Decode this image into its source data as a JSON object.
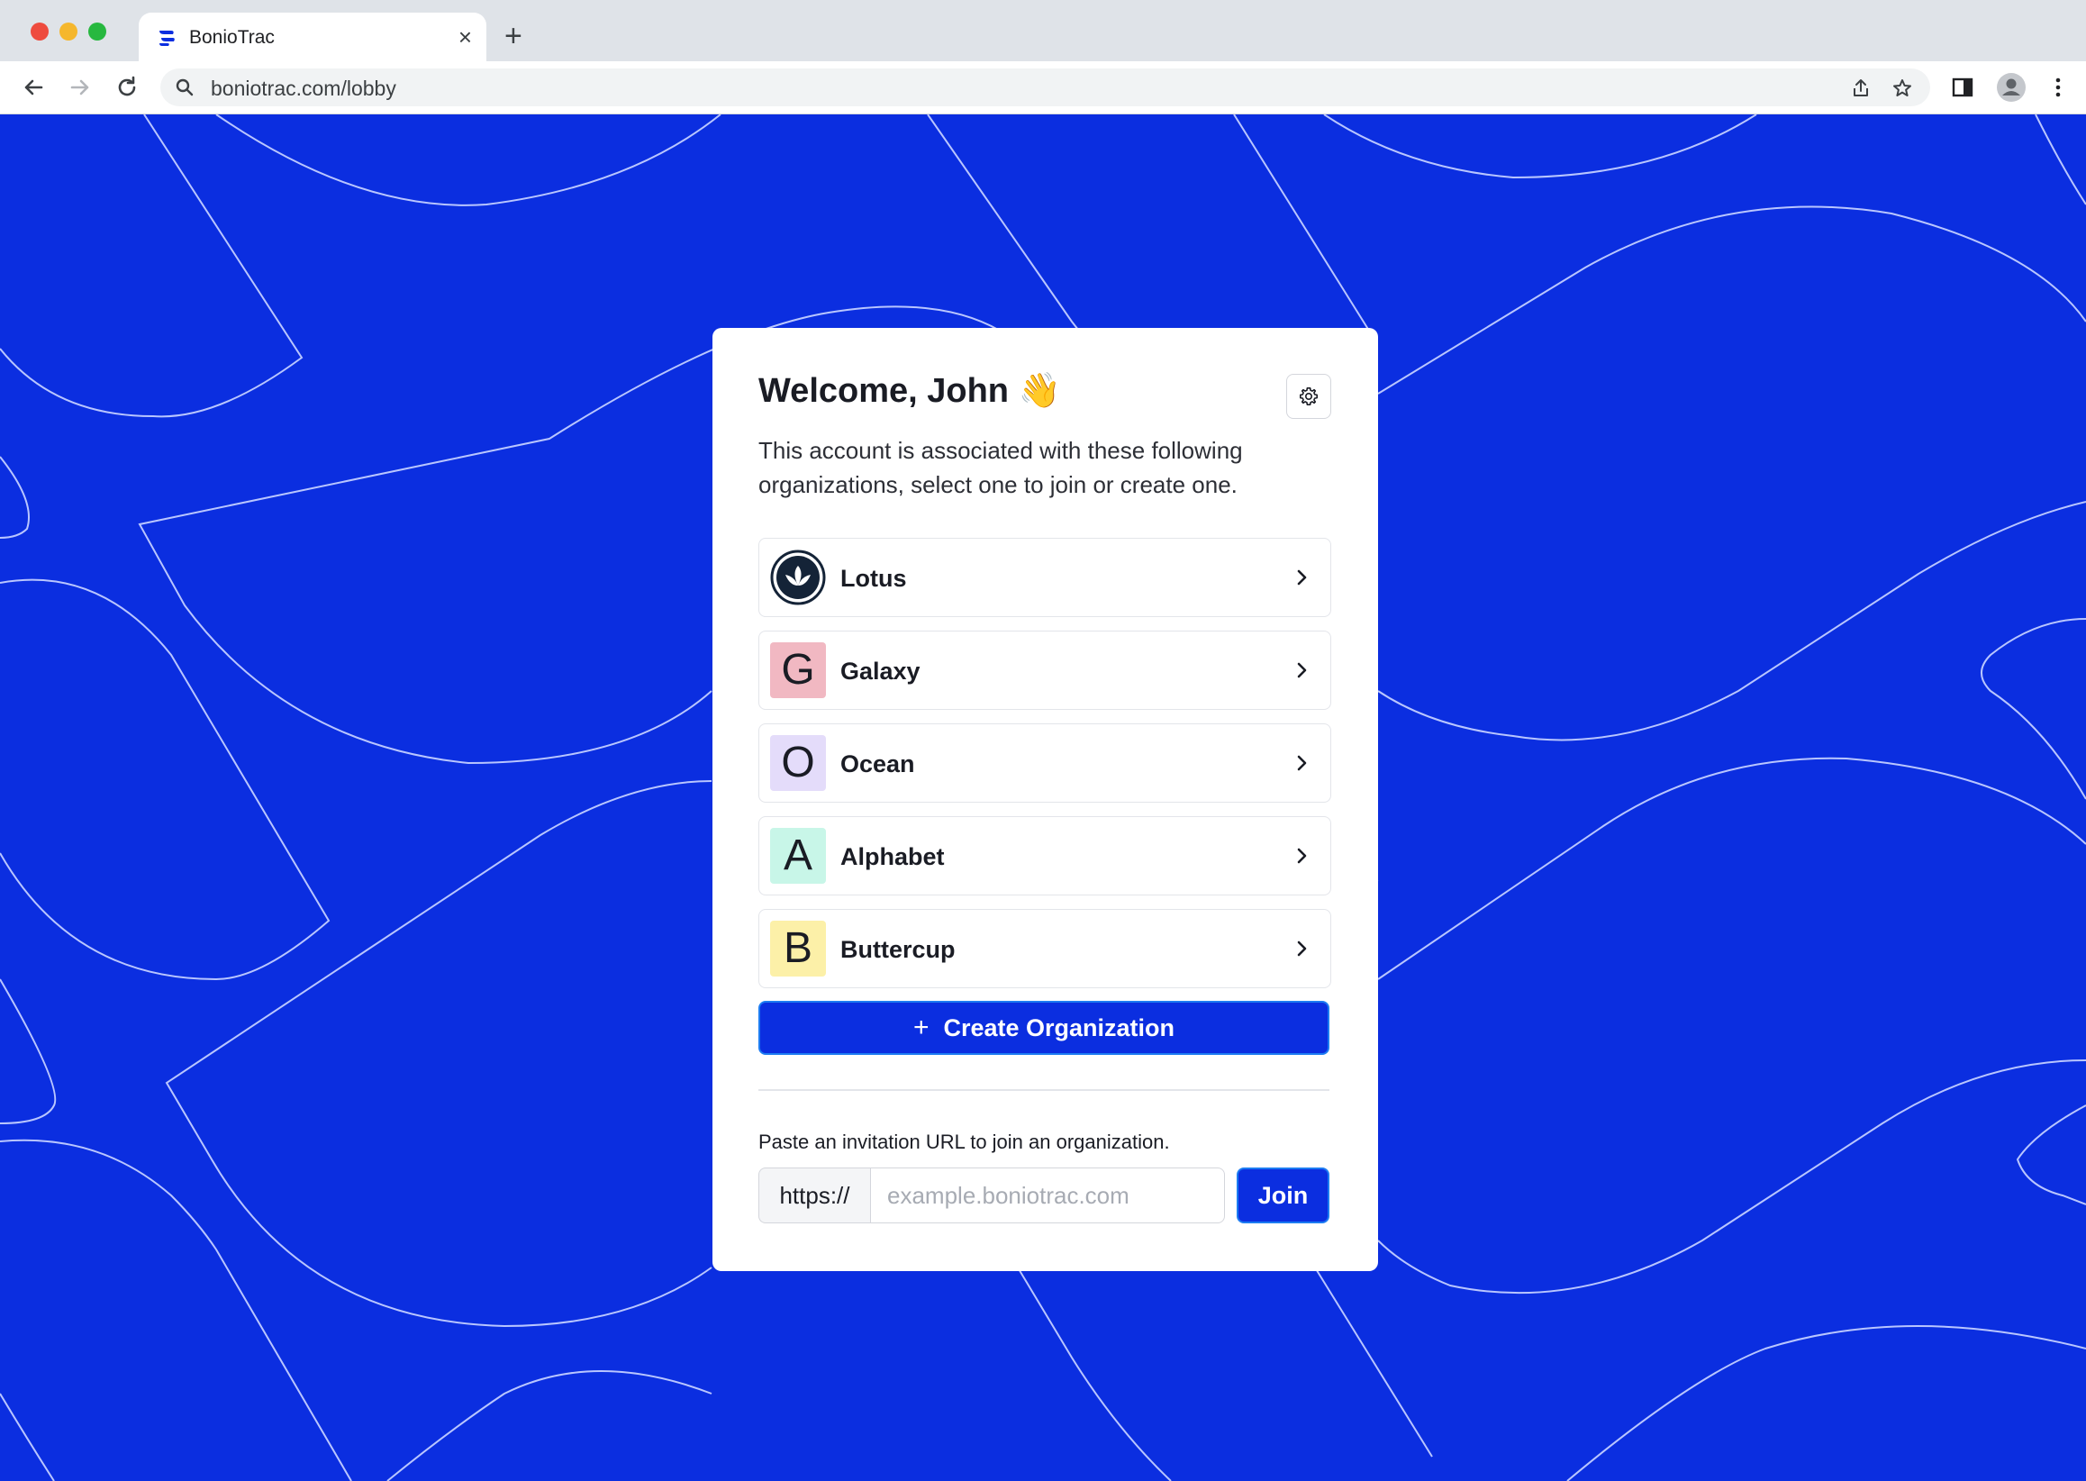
{
  "browser": {
    "tab_title": "BonioTrac",
    "tab_close": "×",
    "new_tab": "+",
    "url": "boniotrac.com/lobby"
  },
  "card": {
    "welcome": "Welcome, John 👋",
    "subtitle": "This account is associated with these following organizations, select one to join or create one.",
    "organizations": [
      {
        "name": "Lotus",
        "initial": "",
        "avatar": "lotus-logo"
      },
      {
        "name": "Galaxy",
        "initial": "G",
        "color": "#f1b8c2"
      },
      {
        "name": "Ocean",
        "initial": "O",
        "color": "#e4dcfa"
      },
      {
        "name": "Alphabet",
        "initial": "A",
        "color": "#c8f6e8"
      },
      {
        "name": "Buttercup",
        "initial": "B",
        "color": "#fcf0a8"
      }
    ],
    "create_label": "Create Organization",
    "create_icon": "+",
    "invite_label": "Paste an invitation URL to join an organization.",
    "url_prefix": "https://",
    "url_placeholder": "example.boniotrac.com",
    "join_label": "Join"
  },
  "colors": {
    "brand": "#0b2ee0",
    "focus_ring": "#1d7cf2"
  }
}
